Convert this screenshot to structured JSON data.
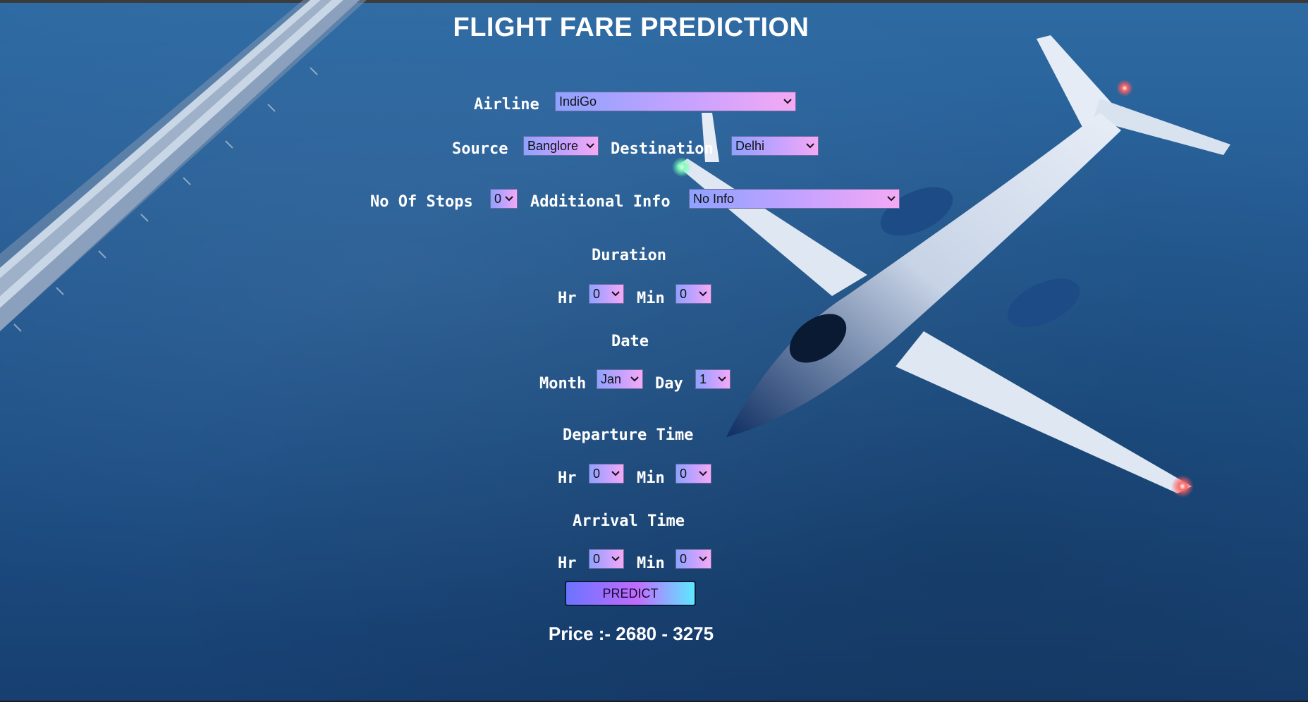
{
  "page": {
    "title": "FLIGHT FARE PREDICTION"
  },
  "form": {
    "airline": {
      "label": "Airline",
      "value": "IndiGo"
    },
    "source": {
      "label": "Source",
      "value": "Banglore"
    },
    "destination": {
      "label": "Destination",
      "value": "Delhi"
    },
    "stops": {
      "label": "No Of Stops",
      "value": "0"
    },
    "additional_info": {
      "label": "Additional Info",
      "value": "No Info"
    },
    "duration": {
      "heading": "Duration",
      "hr_label": "Hr",
      "hr_value": "0",
      "min_label": "Min",
      "min_value": "0"
    },
    "date": {
      "heading": "Date",
      "month_label": "Month",
      "month_value": "Jan",
      "day_label": "Day",
      "day_value": "1"
    },
    "departure": {
      "heading": "Departure Time",
      "hr_label": "Hr",
      "hr_value": "0",
      "min_label": "Min",
      "min_value": "0"
    },
    "arrival": {
      "heading": "Arrival Time",
      "hr_label": "Hr",
      "hr_value": "0",
      "min_label": "Min",
      "min_value": "0"
    },
    "predict_label": "PREDICT"
  },
  "result": {
    "price_text": "Price :- 2680 - 3275"
  },
  "icons": {
    "dropdown": "chevron-down-icon"
  },
  "colors": {
    "background": "#245b93",
    "select_gradient_start": "#8ea2ff",
    "select_gradient_end": "#f4a9f4",
    "button_gradient_start": "#6b74ff",
    "button_gradient_end": "#5ee9ff",
    "text": "#ffffff"
  }
}
